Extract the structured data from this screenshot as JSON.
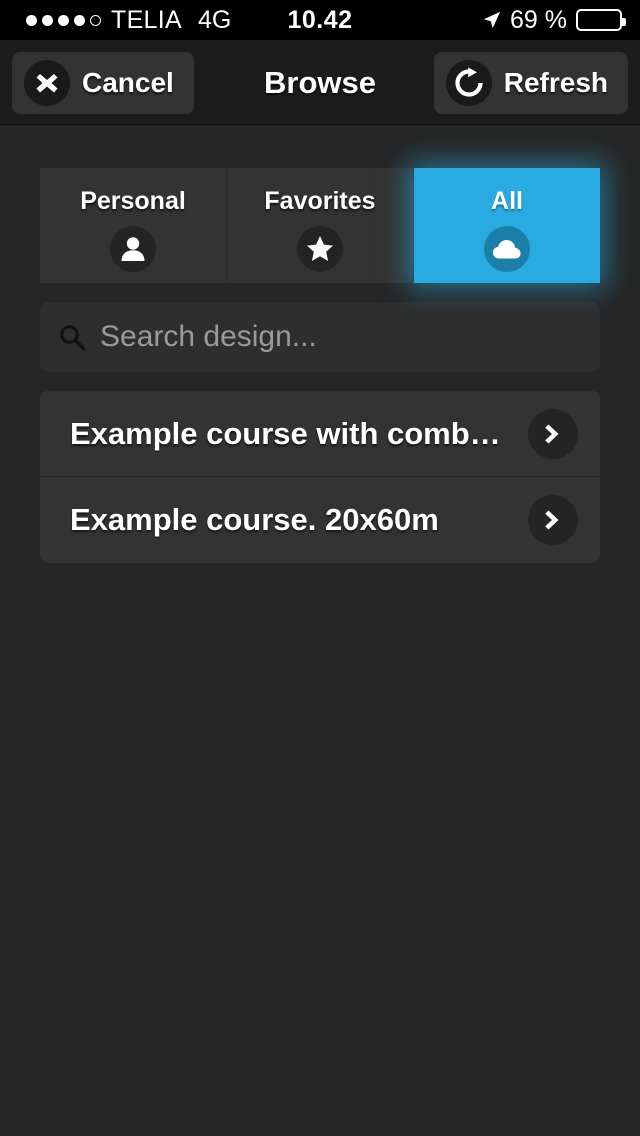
{
  "status_bar": {
    "signal_dots_filled": 4,
    "signal_dots_total": 5,
    "carrier": "TELIA",
    "network": "4G",
    "time": "10.42",
    "battery_percent_label": "69 %",
    "battery_level": 69,
    "location_icon": "location-arrow-icon",
    "battery_icon": "battery-icon"
  },
  "navbar": {
    "title": "Browse",
    "cancel_label": "Cancel",
    "cancel_icon": "close-x-icon",
    "refresh_label": "Refresh",
    "refresh_icon": "refresh-icon"
  },
  "tabs": {
    "selected_index": 2,
    "items": [
      {
        "label": "Personal",
        "icon": "person-icon",
        "selected": false
      },
      {
        "label": "Favorites",
        "icon": "star-icon",
        "selected": false
      },
      {
        "label": "All",
        "icon": "cloud-icon",
        "selected": true
      }
    ]
  },
  "search": {
    "icon": "search-icon",
    "value": "",
    "placeholder": "Search design..."
  },
  "list": {
    "rows": [
      {
        "title": "Example course with comb…",
        "chevron": "chevron-right-icon"
      },
      {
        "title": "Example course. 20x60m",
        "chevron": "chevron-right-icon"
      }
    ]
  },
  "colors": {
    "accent": "#29ABE2",
    "accent_dark": "#1b7faa",
    "page_background": "#262626",
    "panel": "#333333",
    "navbar": "#1c1c1c",
    "status_bar": "#000000"
  }
}
